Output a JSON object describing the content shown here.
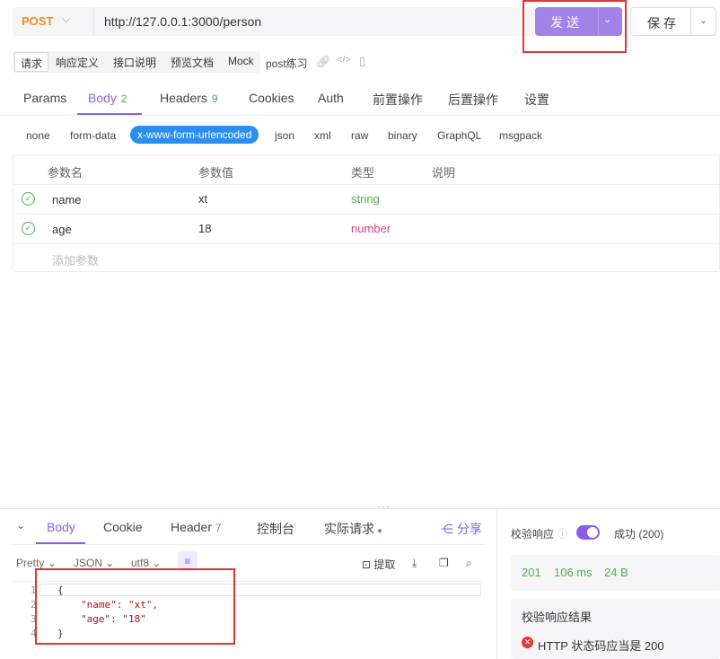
{
  "request": {
    "method": "POST",
    "url": "http://127.0.0.1:3000/person",
    "send_label": "发送",
    "save_label": "保存"
  },
  "subtabs": [
    "请求",
    "响应定义",
    "接口说明",
    "预览文档",
    "Mock"
  ],
  "doc_name": "post练习",
  "main_tabs": {
    "params": "Params",
    "body": "Body",
    "body_count": "2",
    "headers": "Headers",
    "headers_count": "9",
    "cookies": "Cookies",
    "auth": "Auth",
    "pre": "前置操作",
    "post": "后置操作",
    "settings": "设置"
  },
  "body_types": [
    "none",
    "form-data",
    "x-www-form-urlencoded",
    "json",
    "xml",
    "raw",
    "binary",
    "GraphQL",
    "msgpack"
  ],
  "params_table": {
    "headers": [
      "参数名",
      "参数值",
      "类型",
      "说明"
    ],
    "rows": [
      {
        "name": "name",
        "value": "xt",
        "type": "string",
        "type_color": "#4caf50"
      },
      {
        "name": "age",
        "value": "18",
        "type": "number",
        "type_color": "#e0408f"
      }
    ],
    "add_placeholder": "添加参数"
  },
  "response": {
    "tabs": {
      "body": "Body",
      "cookie": "Cookie",
      "header": "Header",
      "header_count": "7",
      "console": "控制台",
      "actual": "实际请求",
      "share": "分享"
    },
    "format": {
      "pretty": "Pretty",
      "lang": "JSON",
      "encoding": "utf8",
      "extract": "提取"
    },
    "code_lines": [
      "{",
      "\"name\": \"xt\",",
      "\"age\": \"18\"",
      "}"
    ],
    "line_numbers": [
      "1",
      "2",
      "3",
      "4"
    ],
    "validate_label": "校验响应",
    "validate_status": "成功 (200)",
    "status_code": "201",
    "time": "106 ms",
    "size": "24 B",
    "result_title": "校验响应结果",
    "result_message": "HTTP 状态码应当是 200"
  }
}
